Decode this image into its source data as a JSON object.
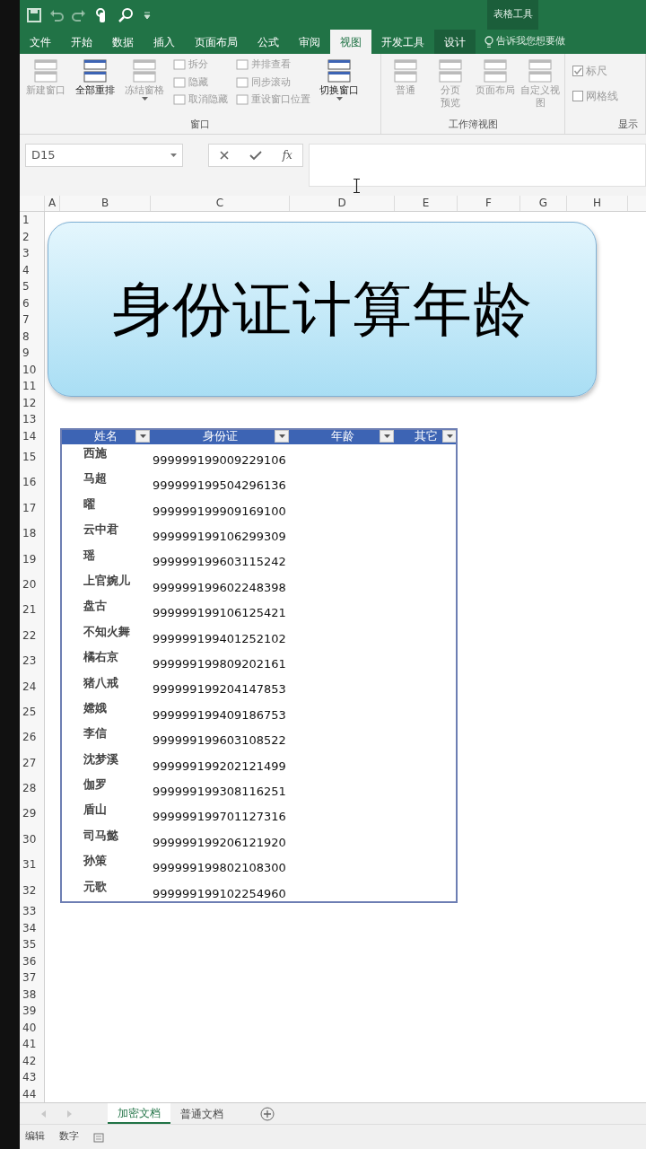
{
  "title_bar": {
    "context_label": "表格工具"
  },
  "ribbon_tabs": [
    {
      "label": "文件",
      "selected": false
    },
    {
      "label": "开始",
      "selected": false
    },
    {
      "label": "数据",
      "selected": false
    },
    {
      "label": "插入",
      "selected": false
    },
    {
      "label": "页面布局",
      "selected": false
    },
    {
      "label": "公式",
      "selected": false
    },
    {
      "label": "审阅",
      "selected": false
    },
    {
      "label": "视图",
      "selected": true
    },
    {
      "label": "开发工具",
      "selected": false
    },
    {
      "label": "设计",
      "selected": false
    }
  ],
  "tell_me": "告诉我您想要做",
  "ribbon": {
    "groups": [
      {
        "label": "窗口",
        "items": [
          {
            "kind": "large",
            "label": "新建窗口",
            "disabled": true
          },
          {
            "kind": "large",
            "label": "全部重排",
            "disabled": false
          },
          {
            "kind": "large",
            "label": "冻结窗格",
            "disabled": true,
            "dropdown": true
          },
          {
            "kind": "stack",
            "items": [
              {
                "label": "拆分",
                "disabled": true
              },
              {
                "label": "隐藏",
                "disabled": true
              },
              {
                "label": "取消隐藏",
                "disabled": true
              }
            ]
          },
          {
            "kind": "stack",
            "items": [
              {
                "label": "并排查看",
                "disabled": true
              },
              {
                "label": "同步滚动",
                "disabled": true
              },
              {
                "label": "重设窗口位置",
                "disabled": true
              }
            ]
          },
          {
            "kind": "large",
            "label": "切换窗口",
            "disabled": false,
            "dropdown": true
          }
        ]
      },
      {
        "label": "工作簿视图",
        "items": [
          {
            "kind": "large",
            "label": "普通",
            "disabled": true
          },
          {
            "kind": "large",
            "label": "分页预览",
            "disabled": true
          },
          {
            "kind": "large",
            "label": "页面布局",
            "disabled": true
          },
          {
            "kind": "large",
            "label": "自定义视图",
            "disabled": true
          }
        ]
      },
      {
        "label": "显示",
        "items": [
          {
            "kind": "checkbox",
            "label": "标尺",
            "checked": true,
            "disabled": true
          },
          {
            "kind": "checkbox",
            "label": "网格线",
            "checked": false,
            "disabled": true
          }
        ]
      }
    ]
  },
  "formula_bar": {
    "name_box": "D15",
    "function_button": "fx"
  },
  "columns": [
    "A",
    "B",
    "C",
    "D",
    "E",
    "F",
    "G",
    "H"
  ],
  "row_headers": [
    "1",
    "2",
    "3",
    "4",
    "5",
    "6",
    "7",
    "8",
    "9",
    "10",
    "11",
    "12",
    "13",
    "14",
    "15",
    "16",
    "17",
    "18",
    "19",
    "20",
    "21",
    "22",
    "23",
    "24",
    "25",
    "26",
    "27",
    "28",
    "29",
    "30",
    "31",
    "32",
    "33",
    "34",
    "35",
    "36",
    "37",
    "38",
    "39",
    "40",
    "41",
    "42",
    "43",
    "44"
  ],
  "title_shape": {
    "text": "身份证计算年龄"
  },
  "table": {
    "columns": [
      "姓名",
      "身份证",
      "年龄",
      "其它"
    ],
    "rows": [
      {
        "name": "西施",
        "id": "999999199009229106"
      },
      {
        "name": "马超",
        "id": "999999199504296136"
      },
      {
        "name": "曜",
        "id": "999999199909169100"
      },
      {
        "name": "云中君",
        "id": "999999199106299309"
      },
      {
        "name": "瑶",
        "id": "999999199603115242"
      },
      {
        "name": "上官婉儿",
        "id": "999999199602248398"
      },
      {
        "name": "盘古",
        "id": "999999199106125421"
      },
      {
        "name": "不知火舞",
        "id": "999999199401252102"
      },
      {
        "name": "橘右京",
        "id": "999999199809202161"
      },
      {
        "name": "猪八戒",
        "id": "999999199204147853"
      },
      {
        "name": "嫦娥",
        "id": "999999199409186753"
      },
      {
        "name": "李信",
        "id": "999999199603108522"
      },
      {
        "name": "沈梦溪",
        "id": "999999199202121499"
      },
      {
        "name": "伽罗",
        "id": "999999199308116251"
      },
      {
        "name": "盾山",
        "id": "999999199701127316"
      },
      {
        "name": "司马懿",
        "id": "999999199206121920"
      },
      {
        "name": "孙策",
        "id": "999999199802108300"
      },
      {
        "name": "元歌",
        "id": "999999199102254960"
      }
    ]
  },
  "sheet_tabs": [
    {
      "label": "加密文档",
      "selected": true
    },
    {
      "label": "普通文档",
      "selected": false
    }
  ],
  "status_bar": [
    "编辑",
    "数字"
  ]
}
